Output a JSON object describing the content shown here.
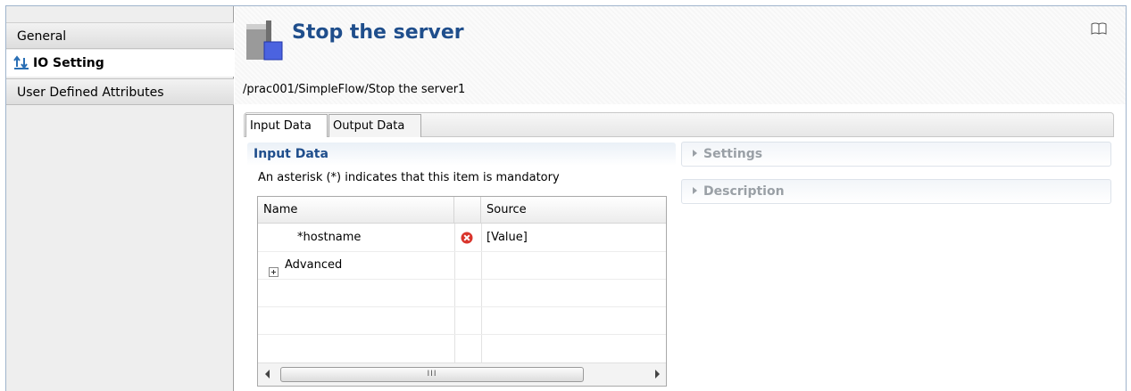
{
  "sidebar": {
    "items": [
      {
        "label": "General"
      },
      {
        "label": "IO Setting",
        "selected": true
      },
      {
        "label": "User Defined Attributes"
      }
    ]
  },
  "header": {
    "title": "Stop the server",
    "path": "/prac001/SimpleFlow/Stop the server1",
    "icon": "server-icon",
    "help_icon": "book-icon"
  },
  "tabs": [
    {
      "label": "Input Data",
      "active": true
    },
    {
      "label": "Output Data",
      "active": false
    }
  ],
  "input_section": {
    "title": "Input Data",
    "note": "An asterisk (*) indicates that this item is mandatory",
    "columns": [
      "Name",
      "",
      "Source"
    ],
    "rows": [
      {
        "name": "*hostname",
        "status_icon": "error-icon",
        "source": "[Value]"
      },
      {
        "name": "Advanced",
        "expandable": true,
        "source": ""
      }
    ],
    "scrollbar_thumb": "III"
  },
  "right_sections": [
    {
      "label": "Settings"
    },
    {
      "label": "Description"
    }
  ],
  "colors": {
    "title": "#1f4e8c",
    "error": "#d9342b"
  }
}
